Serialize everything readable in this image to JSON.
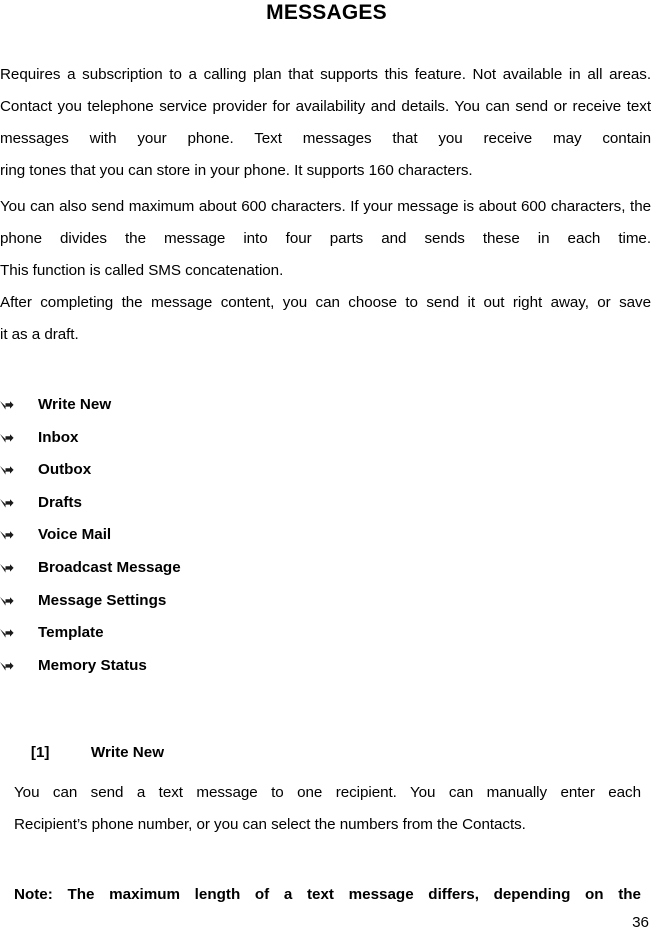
{
  "document": {
    "title": "MESSAGES",
    "page_number": "36",
    "paragraphs": {
      "intro_line1": "Requires a subscription to a calling plan that supports this feature. Not available in all areas. Contact you telephone service provider for availability and details. You can send or receive text messages with your phone. Text messages that you receive may contain",
      "intro_line2": "ring tones that you can store in your phone. It supports 160 characters.",
      "concat_line1": "You can also send maximum about 600 characters. If your message is about 600 characters, the phone divides the message into four parts and sends these in each time.",
      "concat_line2": "This function is called SMS concatenation.",
      "draft_line1": "After completing the message content, you can choose to send it out right away, or save",
      "draft_line2": "it as a draft.",
      "write_new_line1": "You can send a text message to one recipient. You can manually enter each",
      "write_new_line2": "Recipient’s phone number, or you can select the numbers from the Contacts."
    },
    "menu_items": [
      {
        "label": "Write New",
        "bullet": "arrow-bullet-icon"
      },
      {
        "label": "Inbox",
        "bullet": "arrow-bullet-icon"
      },
      {
        "label": "Outbox",
        "bullet": "arrow-bullet-icon"
      },
      {
        "label": "Drafts",
        "bullet": "arrow-bullet-icon"
      },
      {
        "label": "Voice Mail",
        "bullet": "arrow-bullet-icon"
      },
      {
        "label": "Broadcast Message",
        "bullet": "arrow-bullet-icon"
      },
      {
        "label": "Message Settings",
        "bullet": "arrow-bullet-icon"
      },
      {
        "label": "Template",
        "bullet": "arrow-bullet-icon"
      },
      {
        "label": "Memory Status",
        "bullet": "arrow-bullet-icon"
      }
    ],
    "sub_section": {
      "number": "[1]",
      "title": "Write New"
    },
    "note": "Note: The maximum length of a text message differs, depending on the",
    "colors": {
      "text": "#000000",
      "background": "#ffffff",
      "bullet": "#1a1a1a"
    }
  }
}
